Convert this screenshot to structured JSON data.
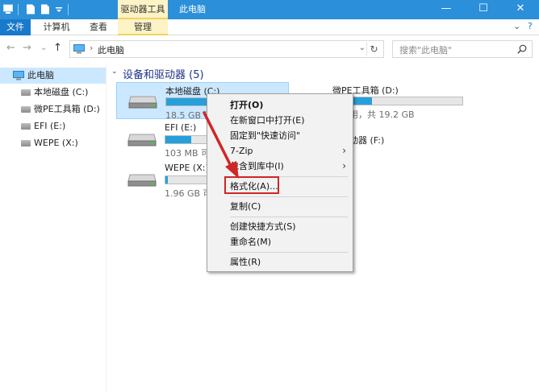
{
  "titlebar": {
    "context_tab": "驱动器工具",
    "title": "此电脑",
    "minimize": "—",
    "maximize": "☐",
    "close": "✕",
    "accent": "#2b8fd9"
  },
  "ribbon": {
    "tabs": [
      "文件",
      "计算机",
      "查看",
      "管理"
    ],
    "collapse": "⌄",
    "help": "?"
  },
  "nav": {
    "back": "←",
    "forward": "→",
    "dropdown": "⌄",
    "up": "↑",
    "crumb_sep": "›",
    "breadcrumb": "此电脑",
    "address_dropdown": "⌄",
    "refresh": "↻",
    "search_placeholder": "搜索\"此电脑\""
  },
  "sidebar": {
    "items": [
      "此电脑",
      "本地磁盘 (C:)",
      "微PE工具箱 (D:)",
      "EFI (E:)",
      "WEPE (X:)"
    ]
  },
  "content": {
    "group_chevron": "⌄",
    "group_title": "设备和驱动器 (5)",
    "drives": [
      {
        "name": "本地磁盘 (C:)",
        "space": "18.5 GB 可用",
        "used_fraction": 0.53
      },
      {
        "name": "EFI (E:)",
        "space": "103 MB 可用",
        "used_fraction": 0.2
      },
      {
        "name": "WEPE (X:)",
        "space": "1.96 GB 可用",
        "used_fraction": 0.02
      },
      {
        "name": "微PE工具箱 (D:)",
        "space": "可用，共 19.2 GB",
        "used_fraction": 0.3
      },
      {
        "name": "驱动器 (F:)"
      }
    ]
  },
  "context_menu": {
    "submenu_arrow": "›",
    "items": [
      "打开(O)",
      "在新窗口中打开(E)",
      "固定到\"快速访问\"",
      "7-Zip",
      "包含到库中(I)",
      "格式化(A)...",
      "复制(C)",
      "创建快捷方式(S)",
      "重命名(M)",
      "属性(R)"
    ],
    "highlight_color": "#d02626"
  }
}
